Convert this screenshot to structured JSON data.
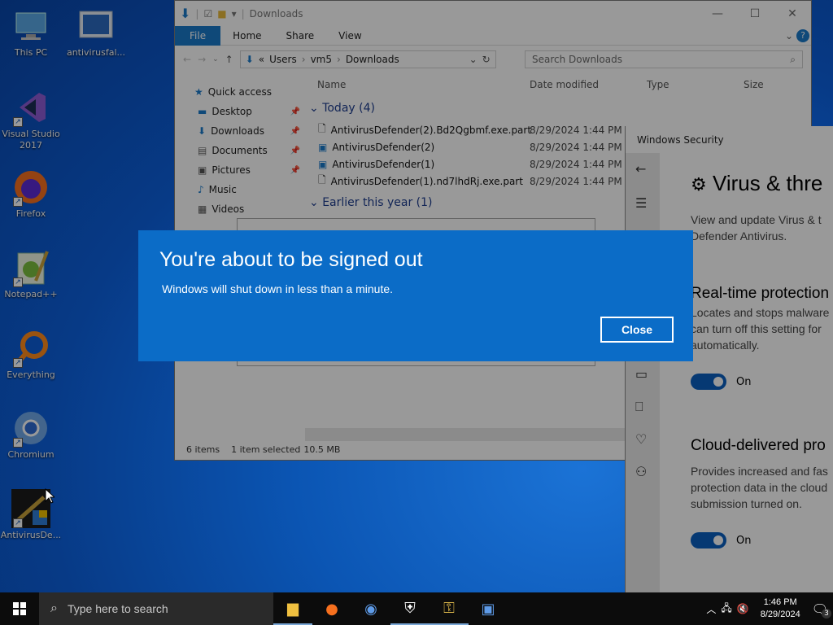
{
  "desktop": {
    "icons": [
      {
        "label": "This PC"
      },
      {
        "label": "antivirusfal..."
      },
      {
        "label": "Visual Studio 2017"
      },
      {
        "label": "Firefox"
      },
      {
        "label": "Notepad++"
      },
      {
        "label": "Everything"
      },
      {
        "label": "Chromium"
      },
      {
        "label": "AntivirusDe..."
      }
    ]
  },
  "explorer": {
    "title": "Downloads",
    "tabs": [
      "File",
      "Home",
      "Share",
      "View"
    ],
    "breadcrumb": [
      "«",
      "Users",
      "vm5",
      "Downloads"
    ],
    "search_placeholder": "Search Downloads",
    "nav": [
      "Quick access",
      "Desktop",
      "Downloads",
      "Documents",
      "Pictures",
      "Music",
      "Videos"
    ],
    "columns": [
      "Name",
      "Date modified",
      "Type",
      "Size"
    ],
    "group_today": "Today (4)",
    "group_earlier": "Earlier this year (1)",
    "files": [
      {
        "name": "AntivirusDefender(2).Bd2Qgbmf.exe.part",
        "date": "8/29/2024 1:44 PM"
      },
      {
        "name": "AntivirusDefender(2)",
        "date": "8/29/2024 1:44 PM"
      },
      {
        "name": "AntivirusDefender(1)",
        "date": "8/29/2024 1:44 PM"
      },
      {
        "name": "AntivirusDefender(1).nd7lhdRj.exe.part",
        "date": "8/29/2024 1:44 PM"
      }
    ],
    "status": {
      "items": "6 items",
      "selected": "1 item selected",
      "size": "10.5 MB"
    }
  },
  "security": {
    "title": "Windows Security",
    "heading": "Virus & thre",
    "desc": "View and update Virus & t Defender Antivirus.",
    "rt_title": "Real-time protection",
    "rt_desc": "Locates and stops malware can turn off this setting for automatically.",
    "rt_state": "On",
    "cloud_title": "Cloud-delivered pro",
    "cloud_desc": "Provides increased and fas protection data in the cloud submission turned on.",
    "cloud_state": "On"
  },
  "dialog": {
    "title": "You're about to be signed out",
    "message": "Windows will shut down in less than a minute.",
    "close_label": "Close"
  },
  "taskbar": {
    "search_placeholder": "Type here to search",
    "time": "1:46 PM",
    "date": "8/29/2024",
    "notif_count": "3"
  }
}
